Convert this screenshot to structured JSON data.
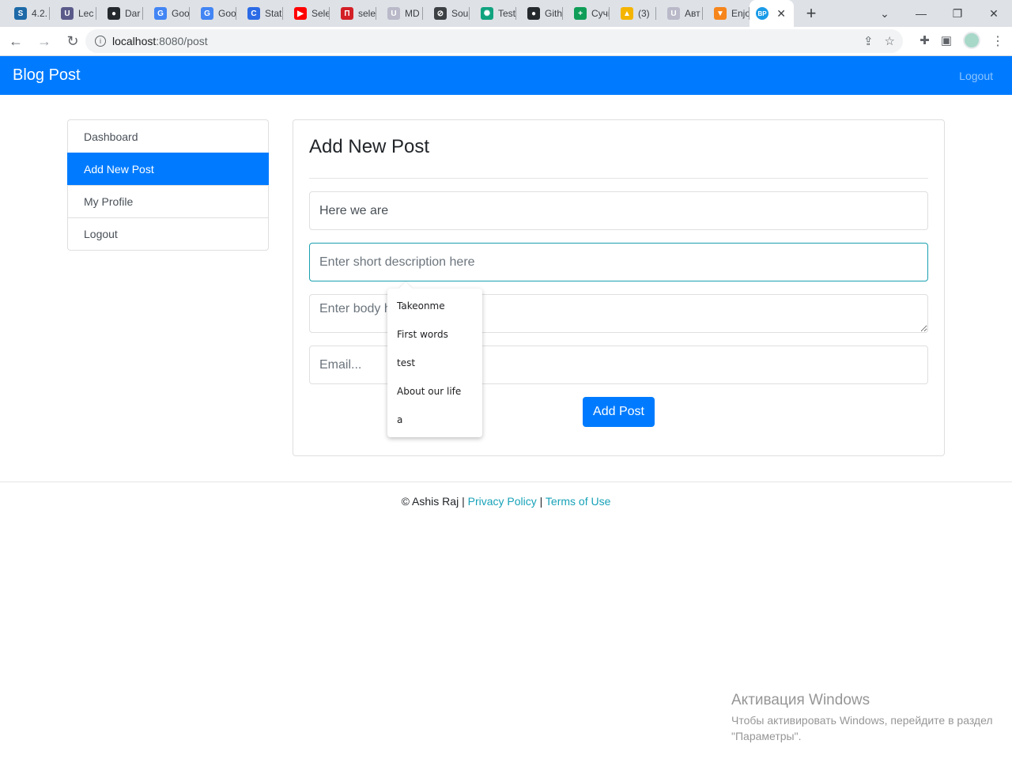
{
  "browser": {
    "tabs": [
      {
        "title": "4.2.",
        "icon": "stepik-icon",
        "color": "#1e6aa8"
      },
      {
        "title": "Lec",
        "icon": "edu-icon",
        "color": "#5a5a8a"
      },
      {
        "title": "Dar",
        "icon": "github-icon",
        "color": "#24292e"
      },
      {
        "title": "Goo",
        "icon": "google-translate-icon",
        "color": "#4285f4"
      },
      {
        "title": "Goo",
        "icon": "google-translate-icon",
        "color": "#4285f4"
      },
      {
        "title": "Stat",
        "icon": "c-icon",
        "color": "#2b6be6"
      },
      {
        "title": "Sele",
        "icon": "youtube-icon",
        "color": "#ff0000"
      },
      {
        "title": "sele",
        "icon": "n-icon",
        "color": "#d31f26"
      },
      {
        "title": "MD",
        "icon": "udemy-icon",
        "color": "#b9b9c9"
      },
      {
        "title": "Sou",
        "icon": "compass-icon",
        "color": "#3c4043"
      },
      {
        "title": "Test",
        "icon": "chatgpt-icon",
        "color": "#10a37f"
      },
      {
        "title": "Gith",
        "icon": "github-icon",
        "color": "#24292e"
      },
      {
        "title": "Сучі",
        "icon": "plus-square-icon",
        "color": "#0f9d58"
      },
      {
        "title": "(3)",
        "icon": "bell-icon",
        "color": "#f4b400"
      },
      {
        "title": "Авт",
        "icon": "udemy-icon",
        "color": "#b9b9c9"
      },
      {
        "title": "Enjo",
        "icon": "fox-icon",
        "color": "#f6851b"
      }
    ],
    "active_tab": {
      "label": "BP",
      "color": "#1a9be8"
    },
    "url_host": "localhost",
    "url_rest": ":8080/post"
  },
  "navbar": {
    "brand": "Blog Post",
    "logout": "Logout"
  },
  "sidebar": {
    "items": [
      {
        "label": "Dashboard",
        "active": false
      },
      {
        "label": "Add New Post",
        "active": true
      },
      {
        "label": "My Profile",
        "active": false
      },
      {
        "label": "Logout",
        "active": false
      }
    ]
  },
  "form": {
    "heading": "Add New Post",
    "title_value": "Here we are",
    "description_placeholder": "Enter short description here",
    "body_placeholder": "Enter body here",
    "email_placeholder": "Email...",
    "submit_label": "Add Post"
  },
  "autocomplete": {
    "options": [
      "Takeonme",
      "First words",
      "test",
      "About our life",
      "a"
    ]
  },
  "footer": {
    "copyright": "© Ashis Raj",
    "separator": "|",
    "privacy": "Privacy Policy",
    "terms": "Terms of Use"
  },
  "watermark": {
    "title": "Активация Windows",
    "text": "Чтобы активировать Windows, перейдите в раздел \"Параметры\"."
  }
}
